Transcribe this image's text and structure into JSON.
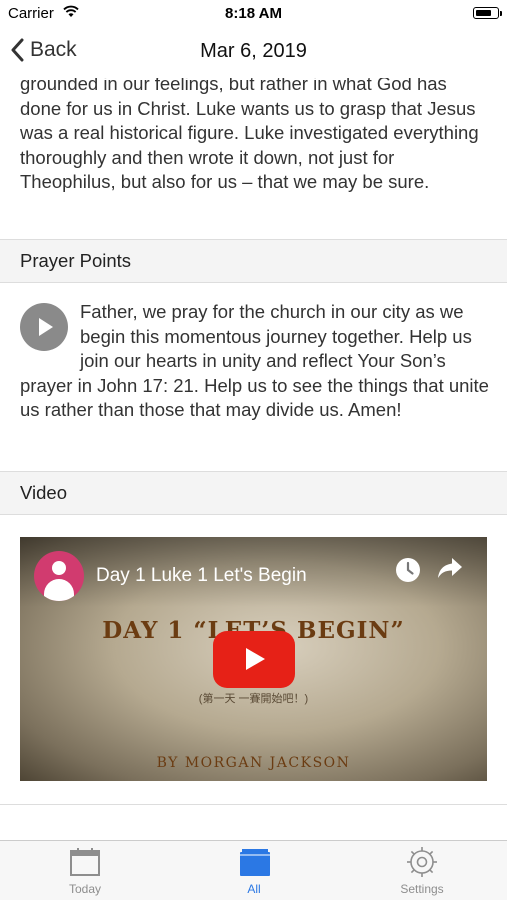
{
  "status_bar": {
    "carrier": "Carrier",
    "time": "8:18 AM"
  },
  "nav": {
    "back_label": "Back",
    "title": "Mar 6, 2019"
  },
  "intro_text": "grounded in our feelings, but rather in what God has done for us in Christ. Luke wants us to grasp that Jesus was a real historical figure. Luke investigated everything thoroughly and then wrote it down, not just for Theophilus, but also for us – that we may be sure.",
  "prayer": {
    "header": "Prayer Points",
    "text": "Father, we pray for the church in our city as we begin this momentous journey together. Help us join our hearts in unity and reflect Your Son’s prayer in John 17: 21. Help us to see the things that unite us rather than those that may divide us. Amen!"
  },
  "video": {
    "header": "Video",
    "title": "Day 1 Luke 1 Let's Begin",
    "art_title": "DAY 1 “LET’S BEGIN”",
    "art_subtitle": "(第一天 一賽開始吧！)",
    "art_byline": "BY MORGAN JACKSON"
  },
  "tabs": [
    {
      "label": "Today",
      "icon": "calendar-icon",
      "active": false
    },
    {
      "label": "All",
      "icon": "folder-icon",
      "active": true
    },
    {
      "label": "Settings",
      "icon": "gear-icon",
      "active": false
    }
  ],
  "colors": {
    "accent": "#2b78e4",
    "youtube_red": "#e62117",
    "section_bg": "#f4f4f4"
  }
}
